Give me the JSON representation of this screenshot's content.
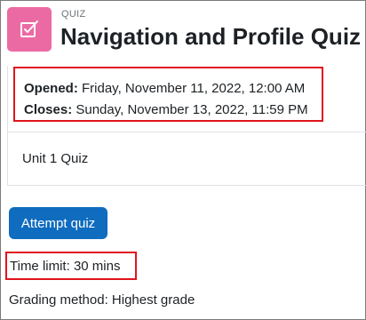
{
  "header": {
    "icon": "quiz-checkbox-icon",
    "module_type": "QUIZ",
    "title": "Navigation and Profile Quiz"
  },
  "dates": {
    "opened_label": "Opened:",
    "opened_value": " Friday, November 11, 2022, 12:00 AM",
    "closes_label": "Closes:",
    "closes_value": " Sunday, November 13, 2022, 11:59 PM"
  },
  "description": "Unit 1 Quiz",
  "actions": {
    "attempt_label": "Attempt quiz"
  },
  "quiz_info": {
    "time_limit": "Time limit: 30 mins",
    "grading_method": "Grading method: Highest grade"
  },
  "colors": {
    "icon_bg": "#ec6aa3",
    "primary_button": "#0f6cbf",
    "highlight_border": "#e0141e"
  }
}
